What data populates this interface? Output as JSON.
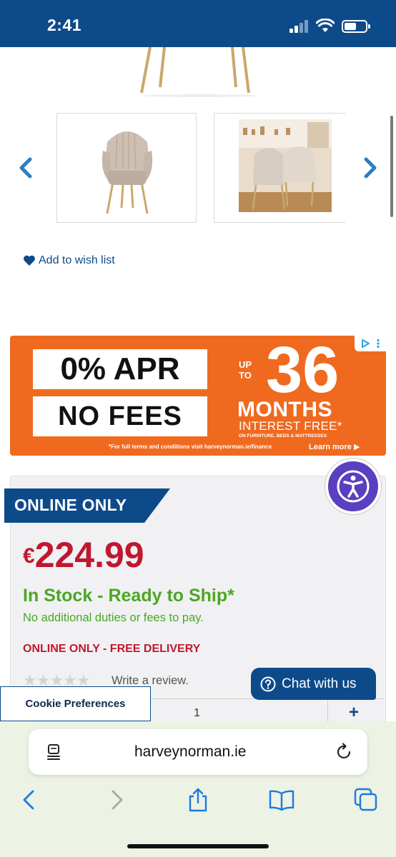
{
  "status_bar": {
    "time": "2:41"
  },
  "product": {
    "wishlist_label": "Add to wish list",
    "badge": "ONLINE ONLY",
    "price_currency": "€",
    "price_amount": "224.99",
    "stock_status": "In Stock - Ready to Ship*",
    "duties_note": "No additional duties or fees to pay.",
    "delivery_note": "ONLINE ONLY - FREE DELIVERY",
    "review_link": "Write a review.",
    "rating_stars": "★★★★★",
    "quantity": "1",
    "plus_label": "+"
  },
  "ad": {
    "line1": "0% APR",
    "line2": "NO FEES",
    "up_to": "UP\nTO",
    "number": "36",
    "months": "MONTHS",
    "interest": "INTEREST FREE*",
    "categories": "ON FURNITURE, BEDS & MATTRESSES",
    "terms": "*For full terms and conditions visit harveynorman.ie/finance",
    "learn_more": "Learn more ▶"
  },
  "overlays": {
    "chat_label": "Chat with us",
    "cookie_label": "Cookie Preferences"
  },
  "browser": {
    "url": "harveynorman.ie"
  },
  "colors": {
    "brand_blue": "#0d4a8a",
    "price_red": "#c0182f",
    "stock_green": "#4aa822",
    "ad_orange": "#ef6a1f",
    "accessibility_purple": "#5a3fc0"
  }
}
